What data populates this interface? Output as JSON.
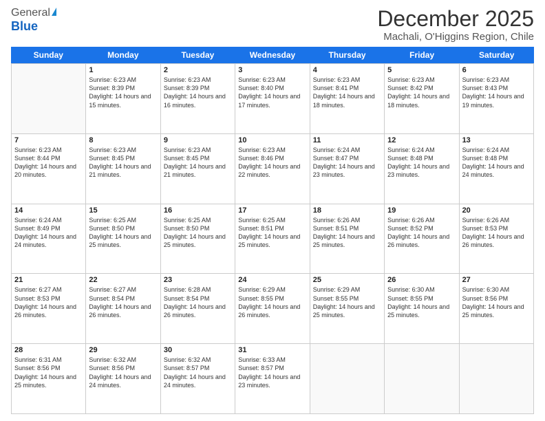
{
  "logo": {
    "general": "General",
    "blue": "Blue"
  },
  "header": {
    "title": "December 2025",
    "subtitle": "Machali, O'Higgins Region, Chile"
  },
  "days_of_week": [
    "Sunday",
    "Monday",
    "Tuesday",
    "Wednesday",
    "Thursday",
    "Friday",
    "Saturday"
  ],
  "weeks": [
    [
      {
        "day": "",
        "empty": true
      },
      {
        "day": "1",
        "sunrise": "Sunrise: 6:23 AM",
        "sunset": "Sunset: 8:39 PM",
        "daylight": "Daylight: 14 hours and 15 minutes."
      },
      {
        "day": "2",
        "sunrise": "Sunrise: 6:23 AM",
        "sunset": "Sunset: 8:39 PM",
        "daylight": "Daylight: 14 hours and 16 minutes."
      },
      {
        "day": "3",
        "sunrise": "Sunrise: 6:23 AM",
        "sunset": "Sunset: 8:40 PM",
        "daylight": "Daylight: 14 hours and 17 minutes."
      },
      {
        "day": "4",
        "sunrise": "Sunrise: 6:23 AM",
        "sunset": "Sunset: 8:41 PM",
        "daylight": "Daylight: 14 hours and 18 minutes."
      },
      {
        "day": "5",
        "sunrise": "Sunrise: 6:23 AM",
        "sunset": "Sunset: 8:42 PM",
        "daylight": "Daylight: 14 hours and 18 minutes."
      },
      {
        "day": "6",
        "sunrise": "Sunrise: 6:23 AM",
        "sunset": "Sunset: 8:43 PM",
        "daylight": "Daylight: 14 hours and 19 minutes."
      }
    ],
    [
      {
        "day": "7",
        "sunrise": "Sunrise: 6:23 AM",
        "sunset": "Sunset: 8:44 PM",
        "daylight": "Daylight: 14 hours and 20 minutes."
      },
      {
        "day": "8",
        "sunrise": "Sunrise: 6:23 AM",
        "sunset": "Sunset: 8:45 PM",
        "daylight": "Daylight: 14 hours and 21 minutes."
      },
      {
        "day": "9",
        "sunrise": "Sunrise: 6:23 AM",
        "sunset": "Sunset: 8:45 PM",
        "daylight": "Daylight: 14 hours and 21 minutes."
      },
      {
        "day": "10",
        "sunrise": "Sunrise: 6:23 AM",
        "sunset": "Sunset: 8:46 PM",
        "daylight": "Daylight: 14 hours and 22 minutes."
      },
      {
        "day": "11",
        "sunrise": "Sunrise: 6:24 AM",
        "sunset": "Sunset: 8:47 PM",
        "daylight": "Daylight: 14 hours and 23 minutes."
      },
      {
        "day": "12",
        "sunrise": "Sunrise: 6:24 AM",
        "sunset": "Sunset: 8:48 PM",
        "daylight": "Daylight: 14 hours and 23 minutes."
      },
      {
        "day": "13",
        "sunrise": "Sunrise: 6:24 AM",
        "sunset": "Sunset: 8:48 PM",
        "daylight": "Daylight: 14 hours and 24 minutes."
      }
    ],
    [
      {
        "day": "14",
        "sunrise": "Sunrise: 6:24 AM",
        "sunset": "Sunset: 8:49 PM",
        "daylight": "Daylight: 14 hours and 24 minutes."
      },
      {
        "day": "15",
        "sunrise": "Sunrise: 6:25 AM",
        "sunset": "Sunset: 8:50 PM",
        "daylight": "Daylight: 14 hours and 25 minutes."
      },
      {
        "day": "16",
        "sunrise": "Sunrise: 6:25 AM",
        "sunset": "Sunset: 8:50 PM",
        "daylight": "Daylight: 14 hours and 25 minutes."
      },
      {
        "day": "17",
        "sunrise": "Sunrise: 6:25 AM",
        "sunset": "Sunset: 8:51 PM",
        "daylight": "Daylight: 14 hours and 25 minutes."
      },
      {
        "day": "18",
        "sunrise": "Sunrise: 6:26 AM",
        "sunset": "Sunset: 8:51 PM",
        "daylight": "Daylight: 14 hours and 25 minutes."
      },
      {
        "day": "19",
        "sunrise": "Sunrise: 6:26 AM",
        "sunset": "Sunset: 8:52 PM",
        "daylight": "Daylight: 14 hours and 26 minutes."
      },
      {
        "day": "20",
        "sunrise": "Sunrise: 6:26 AM",
        "sunset": "Sunset: 8:53 PM",
        "daylight": "Daylight: 14 hours and 26 minutes."
      }
    ],
    [
      {
        "day": "21",
        "sunrise": "Sunrise: 6:27 AM",
        "sunset": "Sunset: 8:53 PM",
        "daylight": "Daylight: 14 hours and 26 minutes."
      },
      {
        "day": "22",
        "sunrise": "Sunrise: 6:27 AM",
        "sunset": "Sunset: 8:54 PM",
        "daylight": "Daylight: 14 hours and 26 minutes."
      },
      {
        "day": "23",
        "sunrise": "Sunrise: 6:28 AM",
        "sunset": "Sunset: 8:54 PM",
        "daylight": "Daylight: 14 hours and 26 minutes."
      },
      {
        "day": "24",
        "sunrise": "Sunrise: 6:29 AM",
        "sunset": "Sunset: 8:55 PM",
        "daylight": "Daylight: 14 hours and 26 minutes."
      },
      {
        "day": "25",
        "sunrise": "Sunrise: 6:29 AM",
        "sunset": "Sunset: 8:55 PM",
        "daylight": "Daylight: 14 hours and 25 minutes."
      },
      {
        "day": "26",
        "sunrise": "Sunrise: 6:30 AM",
        "sunset": "Sunset: 8:55 PM",
        "daylight": "Daylight: 14 hours and 25 minutes."
      },
      {
        "day": "27",
        "sunrise": "Sunrise: 6:30 AM",
        "sunset": "Sunset: 8:56 PM",
        "daylight": "Daylight: 14 hours and 25 minutes."
      }
    ],
    [
      {
        "day": "28",
        "sunrise": "Sunrise: 6:31 AM",
        "sunset": "Sunset: 8:56 PM",
        "daylight": "Daylight: 14 hours and 25 minutes."
      },
      {
        "day": "29",
        "sunrise": "Sunrise: 6:32 AM",
        "sunset": "Sunset: 8:56 PM",
        "daylight": "Daylight: 14 hours and 24 minutes."
      },
      {
        "day": "30",
        "sunrise": "Sunrise: 6:32 AM",
        "sunset": "Sunset: 8:57 PM",
        "daylight": "Daylight: 14 hours and 24 minutes."
      },
      {
        "day": "31",
        "sunrise": "Sunrise: 6:33 AM",
        "sunset": "Sunset: 8:57 PM",
        "daylight": "Daylight: 14 hours and 23 minutes."
      },
      {
        "day": "",
        "empty": true
      },
      {
        "day": "",
        "empty": true
      },
      {
        "day": "",
        "empty": true
      }
    ]
  ]
}
